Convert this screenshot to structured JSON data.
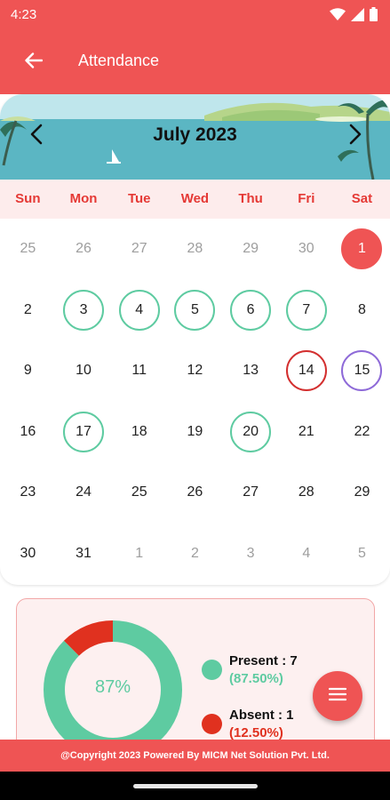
{
  "status_bar": {
    "time": "4:23",
    "icons": [
      "wifi-icon",
      "cell-signal-icon",
      "battery-icon"
    ]
  },
  "app_bar": {
    "title": "Attendance",
    "back_icon": "arrow-left-icon"
  },
  "calendar": {
    "month_label": "July 2023",
    "prev_icon": "chevron-left-icon",
    "next_icon": "chevron-right-icon",
    "weekdays": [
      "Sun",
      "Mon",
      "Tue",
      "Wed",
      "Thu",
      "Fri",
      "Sat"
    ],
    "weeks": [
      [
        {
          "d": "25",
          "t": "other"
        },
        {
          "d": "26",
          "t": "other"
        },
        {
          "d": "27",
          "t": "other"
        },
        {
          "d": "28",
          "t": "other"
        },
        {
          "d": "29",
          "t": "other"
        },
        {
          "d": "30",
          "t": "other"
        },
        {
          "d": "1",
          "t": "holiday"
        }
      ],
      [
        {
          "d": "2",
          "t": ""
        },
        {
          "d": "3",
          "t": "present"
        },
        {
          "d": "4",
          "t": "present"
        },
        {
          "d": "5",
          "t": "present"
        },
        {
          "d": "6",
          "t": "present"
        },
        {
          "d": "7",
          "t": "present"
        },
        {
          "d": "8",
          "t": ""
        }
      ],
      [
        {
          "d": "9",
          "t": ""
        },
        {
          "d": "10",
          "t": ""
        },
        {
          "d": "11",
          "t": ""
        },
        {
          "d": "12",
          "t": ""
        },
        {
          "d": "13",
          "t": ""
        },
        {
          "d": "14",
          "t": "today"
        },
        {
          "d": "15",
          "t": "leave"
        }
      ],
      [
        {
          "d": "16",
          "t": ""
        },
        {
          "d": "17",
          "t": "present"
        },
        {
          "d": "18",
          "t": ""
        },
        {
          "d": "19",
          "t": ""
        },
        {
          "d": "20",
          "t": "present"
        },
        {
          "d": "21",
          "t": ""
        },
        {
          "d": "22",
          "t": ""
        }
      ],
      [
        {
          "d": "23",
          "t": ""
        },
        {
          "d": "24",
          "t": ""
        },
        {
          "d": "25",
          "t": ""
        },
        {
          "d": "26",
          "t": ""
        },
        {
          "d": "27",
          "t": ""
        },
        {
          "d": "28",
          "t": ""
        },
        {
          "d": "29",
          "t": ""
        }
      ],
      [
        {
          "d": "30",
          "t": ""
        },
        {
          "d": "31",
          "t": ""
        },
        {
          "d": "1",
          "t": "other"
        },
        {
          "d": "2",
          "t": "other"
        },
        {
          "d": "3",
          "t": "other"
        },
        {
          "d": "4",
          "t": "other"
        },
        {
          "d": "5",
          "t": "other"
        }
      ]
    ]
  },
  "summary": {
    "percent_label": "87%",
    "present_fraction": 0.875,
    "absent_fraction": 0.125,
    "present": {
      "label": "Present : 7",
      "pct": "(87.50%)",
      "color": "#5ecba1"
    },
    "absent": {
      "label": "Absent :  1",
      "pct": "(12.50%)",
      "color": "#e0311f"
    }
  },
  "fab": {
    "icon": "menu-icon"
  },
  "footer": {
    "text": "@Copyright 2023 Powered By MICM Net Solution Pvt. Ltd."
  },
  "colors": {
    "primary": "#ef5454",
    "present": "#5ecba1",
    "absent": "#e0311f",
    "today": "#d32f2f",
    "leave": "#8e6ad8"
  }
}
